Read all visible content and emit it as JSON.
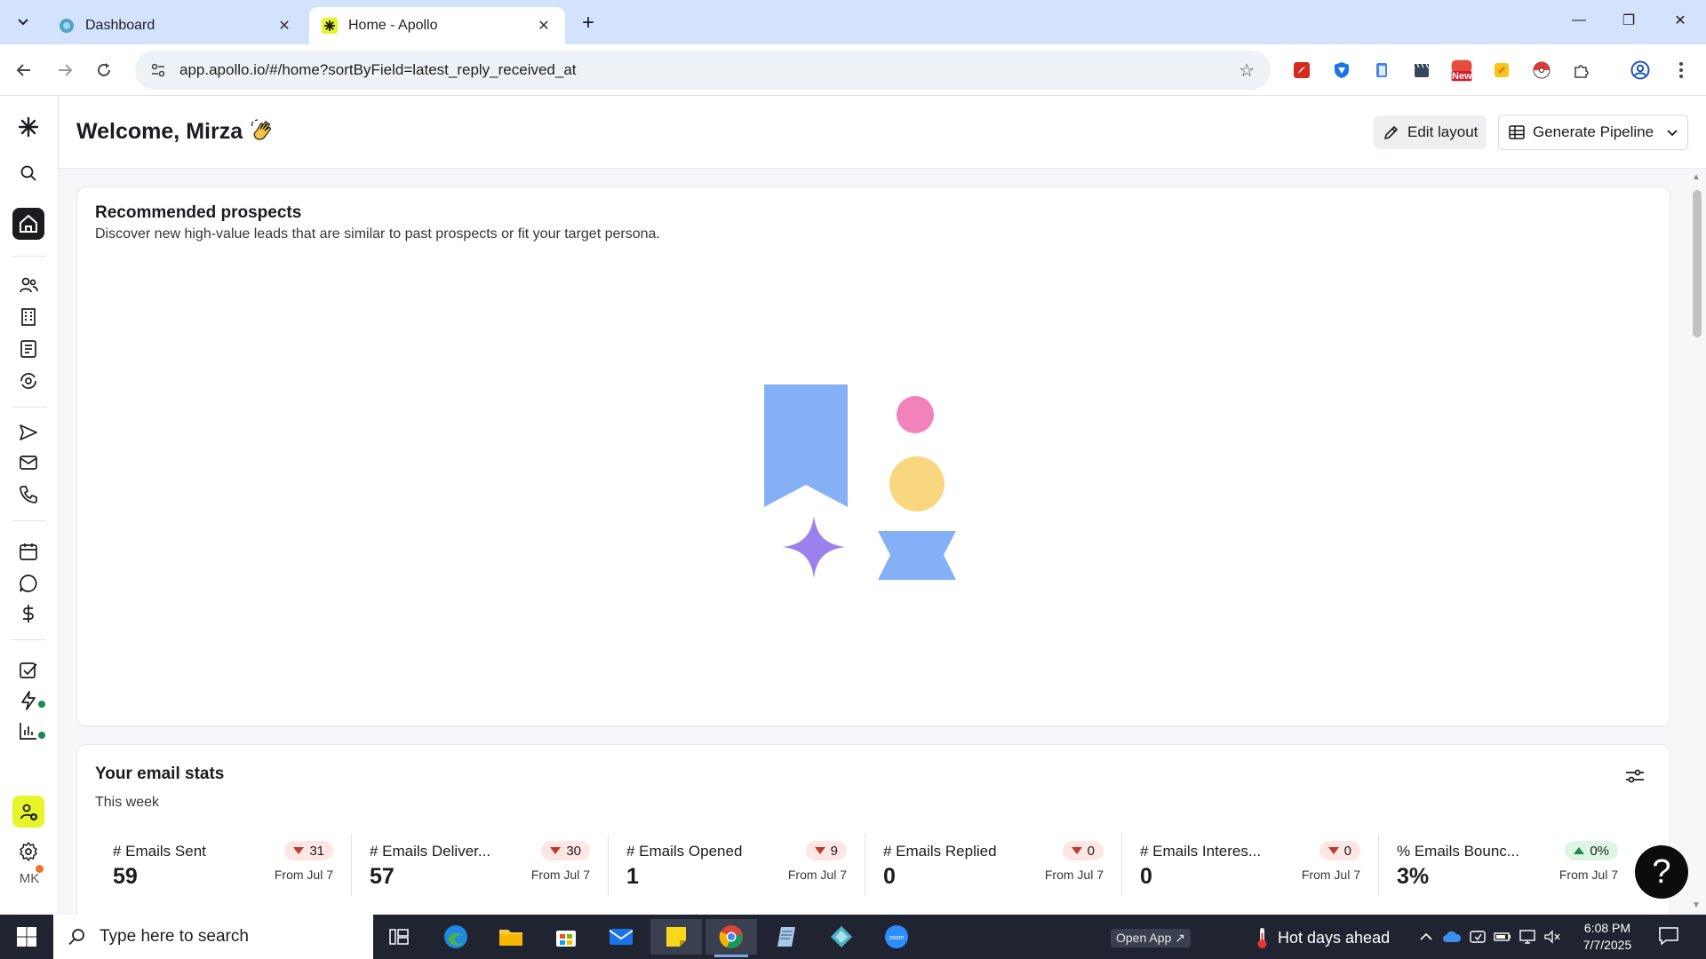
{
  "browser": {
    "tabs": [
      {
        "title": "Dashboard",
        "active": false
      },
      {
        "title": "Home - Apollo",
        "active": true
      }
    ],
    "url": "app.apollo.io/#/home?sortByField=latest_reply_received_at",
    "extension_badge": "New"
  },
  "header": {
    "welcome": "Welcome, Mirza",
    "edit_layout": "Edit layout",
    "generate_pipeline": "Generate Pipeline"
  },
  "rail": {
    "avatar_initials": "MK"
  },
  "recommended": {
    "title": "Recommended prospects",
    "subtitle": "Discover new high-value leads that are similar to past prospects or fit your target persona."
  },
  "email_stats": {
    "title": "Your email stats",
    "period": "This week",
    "stats": [
      {
        "label": "# Emails Sent",
        "value": "59",
        "change": "31",
        "direction": "down",
        "from": "From Jul 7"
      },
      {
        "label": "# Emails Deliver...",
        "value": "57",
        "change": "30",
        "direction": "down",
        "from": "From Jul 7"
      },
      {
        "label": "# Emails Opened",
        "value": "1",
        "change": "9",
        "direction": "down",
        "from": "From Jul 7"
      },
      {
        "label": "# Emails Replied",
        "value": "0",
        "change": "0",
        "direction": "down",
        "from": "From Jul 7"
      },
      {
        "label": "# Emails Interes...",
        "value": "0",
        "change": "0",
        "direction": "down",
        "from": "From Jul 7"
      },
      {
        "label": "% Emails Bounc...",
        "value": "3%",
        "change": "0%",
        "direction": "up",
        "from": "From Jul 7"
      }
    ]
  },
  "help": {
    "label": "?"
  },
  "taskbar": {
    "search_placeholder": "Type here to search",
    "open_app": "Open App ↗",
    "weather": "Hot days ahead",
    "time": "6:08 PM",
    "date": "7/7/2025"
  },
  "colors": {
    "accent_yellow": "#e6f528",
    "home_active": "#1b1c1f",
    "badge_down": "#fde6e4",
    "badge_up": "#dff5e4"
  }
}
